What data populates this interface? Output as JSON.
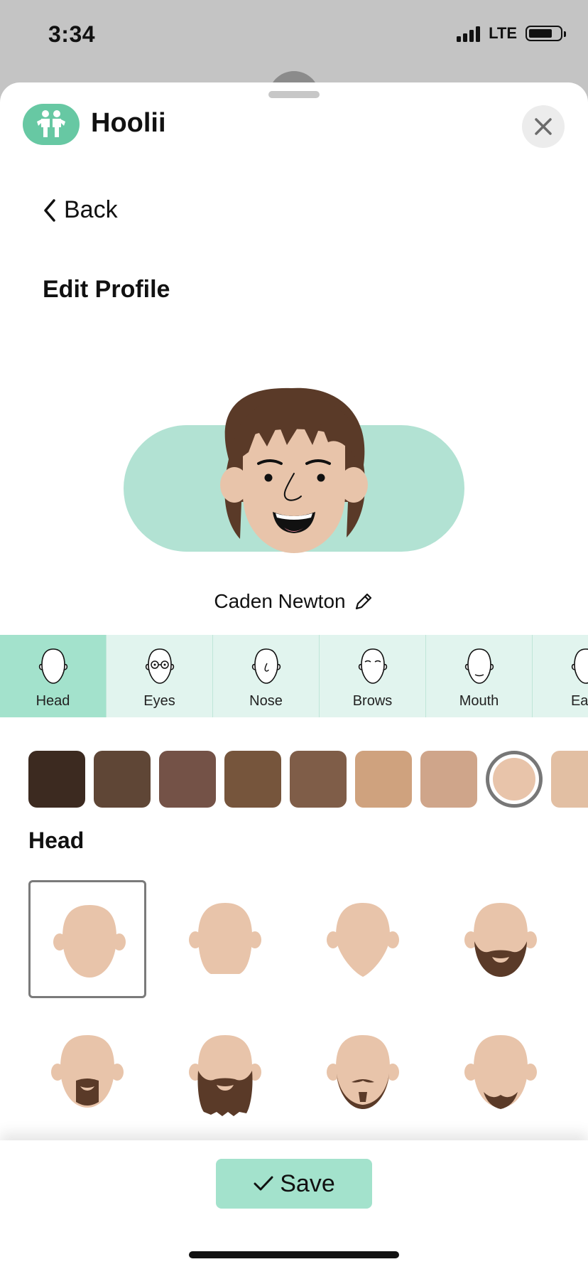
{
  "status_bar": {
    "time": "3:34",
    "network": "LTE"
  },
  "header": {
    "app_name": "Hoolii"
  },
  "nav": {
    "back_label": "Back"
  },
  "page": {
    "title": "Edit Profile"
  },
  "profile": {
    "name": "Caden Newton"
  },
  "tabs": [
    {
      "label": "Head",
      "active": true
    },
    {
      "label": "Eyes",
      "active": false
    },
    {
      "label": "Nose",
      "active": false
    },
    {
      "label": "Brows",
      "active": false
    },
    {
      "label": "Mouth",
      "active": false
    },
    {
      "label": "Ears",
      "active": false
    }
  ],
  "skin_colors": [
    "#3c2a20",
    "#5f4636",
    "#745247",
    "#76553c",
    "#7f5d48",
    "#cfa27e",
    "#cfa58a",
    "#e8c4aa",
    "#e2bfa3"
  ],
  "selected_skin_index": 7,
  "section": {
    "title": "Head"
  },
  "head_options": [
    {
      "style": "plain",
      "selected": true
    },
    {
      "style": "plain-2",
      "selected": false
    },
    {
      "style": "pointed",
      "selected": false
    },
    {
      "style": "full-beard-short",
      "selected": false
    },
    {
      "style": "goatee",
      "selected": false
    },
    {
      "style": "full-beard-long",
      "selected": false
    },
    {
      "style": "chin-strap-mustache",
      "selected": false
    },
    {
      "style": "chin-beard",
      "selected": false
    }
  ],
  "colors": {
    "accent": "#a3e2cc",
    "brand": "#67c8a3",
    "avatar_bg": "#b2e2d3",
    "skin": "#e8c4aa",
    "hair": "#5a3a28"
  },
  "footer": {
    "save_label": "Save"
  }
}
